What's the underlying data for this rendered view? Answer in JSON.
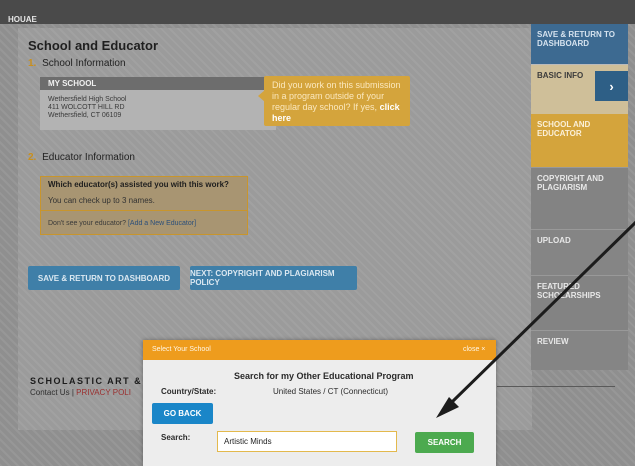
{
  "topbar": {
    "label": "HOUAE"
  },
  "main": {
    "title": "School and Educator",
    "school_step": {
      "number": "1.",
      "label": "School Information"
    },
    "school_card": {
      "header": "MY SCHOOL",
      "name": "Wethersfield High School",
      "address": "411 WOLCOTT HILL RD",
      "city": "Wethersfield, CT 06109"
    },
    "callout": {
      "text": "Did you work on this submission in a program outside of your regular day school? If yes,",
      "link": "click here"
    },
    "educator_step": {
      "number": "2.",
      "label": "Educator Information"
    },
    "educator_box": {
      "question": "Which educator(s) assisted you with this work?",
      "hint": "You can check up to 3 names.",
      "missing_prefix": "Don't see your educator?",
      "add_link": "[Add a New Educator]"
    },
    "buttons": {
      "save": "SAVE & RETURN TO DASHBOARD",
      "next": "NEXT: COPYRIGHT AND PLAGIARISM POLICY"
    }
  },
  "sidebar": {
    "items": [
      {
        "label": "SAVE & RETURN TO DASHBOARD"
      },
      {
        "label": "BASIC INFO"
      },
      {
        "label": "SCHOOL AND EDUCATOR"
      },
      {
        "label": "COPYRIGHT AND PLAGIARISM"
      },
      {
        "label": "UPLOAD"
      },
      {
        "label": "FEATURED SCHOLARSHIPS"
      },
      {
        "label": "REVIEW"
      }
    ],
    "chevron": "›"
  },
  "footer": {
    "brand": "SCHOLASTIC ART & W",
    "contact": "Contact Us",
    "separator": "|",
    "privacy": "PRIVACY POLI"
  },
  "modal": {
    "title": "Select Your School",
    "close": "close ×",
    "heading": "Search for my Other Educational Program",
    "country_label": "Country/State:",
    "country_value": "United States / CT (Connecticut)",
    "go_back": "GO BACK",
    "search_label": "Search:",
    "search_value": "Artistic Minds",
    "search_button": "SEARCH"
  },
  "colors": {
    "accent_orange": "#ee9c1d",
    "accent_blue": "#1a86c8",
    "search_green": "#4caa4f",
    "callout_gold": "#d4a43c"
  }
}
